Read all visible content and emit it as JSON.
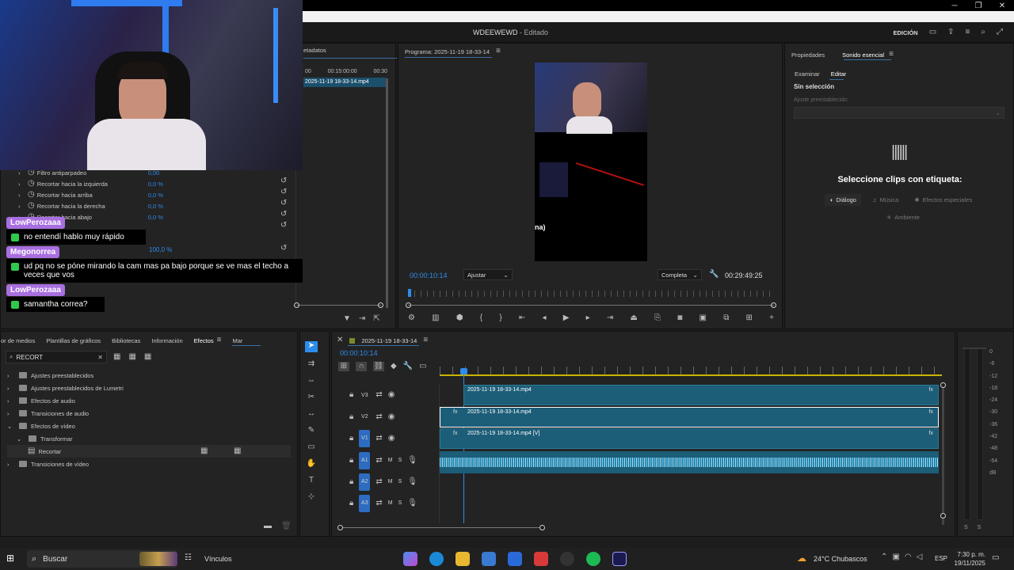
{
  "window": {
    "title": "WDEEWEWD",
    "title_suffix": "Editado",
    "workspace": "EDICIÓN"
  },
  "effect_controls": {
    "tab_fragment": "etadatos",
    "ruler_ticks": [
      "00",
      "00:15:00:00",
      "00:30"
    ],
    "clip_name": "2025-11-19 18-33-14.mp4",
    "props": [
      {
        "label": "Filtro antiparpadeo",
        "value": "0,00"
      },
      {
        "label": "Recortar hacia la izquierda",
        "value": "0,0 %"
      },
      {
        "label": "Recortar hacia arriba",
        "value": "0,0 %"
      },
      {
        "label": "Recortar hacia la derecha",
        "value": "0,0 %"
      },
      {
        "label": "Recortar hacia abajo",
        "value": "0,0 %"
      }
    ],
    "opacity_value": "100,0 %"
  },
  "chat": [
    {
      "user": "LowPerozaaa",
      "message": "no entendí hablo muy rápido"
    },
    {
      "user": "Megonorrea",
      "message": "ud pq no se póne mirando la cam mas pa bajo porque se ve mas el techo a veces que vos"
    },
    {
      "user": "LowPerozaaa",
      "message": "samantha correa?"
    }
  ],
  "program_monitor": {
    "title": "Programa: 2025-11-19 18-33-14",
    "timecode": "00:00:10:14",
    "fit": "Ajustar",
    "quality": "Completa",
    "duration": "00:29:49:25",
    "overlay_text": "na)"
  },
  "essential_sound": {
    "tabs": [
      "Propiedades",
      "Sonido esencial"
    ],
    "subtabs": [
      "Examinar",
      "Editar"
    ],
    "no_selection": "Sin selección",
    "preset_label": "Ajuste preestablecido:",
    "prompt": "Seleccione clips con etiqueta:",
    "types": [
      "Diálogo",
      "Música",
      "Efectos especiales",
      "Ambiente"
    ]
  },
  "effects_panel": {
    "tabs": [
      "or de medios",
      "Plantillas de gráficos",
      "Bibliotecas",
      "Información",
      "Efectos",
      "Mar"
    ],
    "search_value": "RECORT",
    "tree": [
      {
        "label": "Ajustes preestablecidos",
        "level": 0
      },
      {
        "label": "Ajustes preestablecidos de Lumetri",
        "level": 0
      },
      {
        "label": "Efectos de audio",
        "level": 0
      },
      {
        "label": "Transiciones de audio",
        "level": 0
      },
      {
        "label": "Efectos de vídeo",
        "level": 0
      },
      {
        "label": "Transformar",
        "level": 1
      },
      {
        "label": "Recortar",
        "level": 2
      },
      {
        "label": "Transiciones de vídeo",
        "level": 0
      }
    ]
  },
  "timeline": {
    "sequence": "2025-11-19 18-33-14",
    "timecode": "00:00:10:14",
    "tracks": [
      {
        "name": "V3",
        "clip": "2025-11-19 18-33-14.mp4"
      },
      {
        "name": "V2",
        "clip": "2025-11-19 18-33-14.mp4"
      },
      {
        "name": "V1",
        "clip": "2025-11-19 18-33-14.mp4 [V]"
      },
      {
        "name": "A1",
        "clip": ""
      },
      {
        "name": "A2",
        "clip": ""
      },
      {
        "name": "A3",
        "clip": ""
      }
    ],
    "track_m": "M",
    "track_s": "S"
  },
  "meter": {
    "scale": [
      "0",
      "-6",
      "-12",
      "-18",
      "-24",
      "-30",
      "-36",
      "-42",
      "-48",
      "-54",
      "dB"
    ],
    "ch": [
      "S",
      "S"
    ]
  },
  "taskbar": {
    "search": "Buscar",
    "links": "Vínculos",
    "weather": "24°C  Chubascos",
    "lang": "ESP",
    "time": "7:30 p. m.",
    "date": "19/11/2025"
  },
  "colors": {
    "accent": "#2d8ceb",
    "clip": "#1c5d78",
    "chat_name": "#a86fe0"
  }
}
